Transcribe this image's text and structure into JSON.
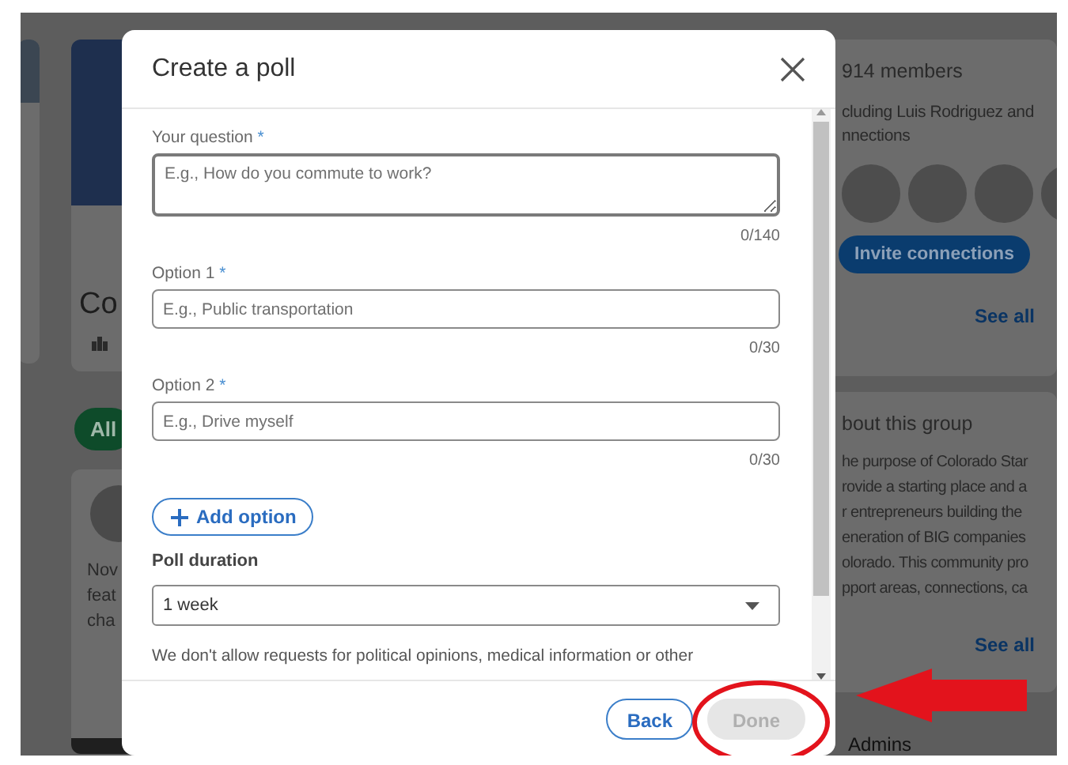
{
  "background": {
    "left_card_title": "Co",
    "filter_pill": {
      "label": "All",
      "selected": true
    },
    "post_lines": [
      "Nov",
      "feat",
      "cha"
    ],
    "members": {
      "count": "914 members",
      "including": "cluding Luis Rodriguez and",
      "connections": "nnections",
      "invite_button": "Invite connections",
      "see_all": "See all"
    },
    "about": {
      "title": "bout this group",
      "lines": [
        "he purpose of Colorado Star",
        "rovide a starting place and a",
        "r entrepreneurs building the",
        "eneration of BIG companies",
        "olorado. This community pro",
        "pport areas, connections, ca"
      ],
      "see_all": "See all"
    },
    "admins_title": "Admins"
  },
  "dialog": {
    "title": "Create a poll",
    "fields": [
      {
        "kind": "textarea",
        "label": "Your question",
        "required_mark": "*",
        "placeholder": "E.g., How do you commute to work?",
        "counter": "0/140"
      },
      {
        "kind": "input",
        "label": "Option 1",
        "required_mark": "*",
        "placeholder": "E.g., Public transportation",
        "counter": "0/30"
      },
      {
        "kind": "input",
        "label": "Option 2",
        "required_mark": "*",
        "placeholder": "E.g., Drive myself",
        "counter": "0/30"
      }
    ],
    "add_option": "Add option",
    "duration": {
      "label": "Poll duration",
      "value": "1 week"
    },
    "notice": "We don't allow requests for political opinions, medical information or other",
    "buttons": [
      {
        "label": "Back",
        "kind": "secondary",
        "disabled": false
      },
      {
        "label": "Done",
        "kind": "primary",
        "disabled": true
      }
    ]
  }
}
